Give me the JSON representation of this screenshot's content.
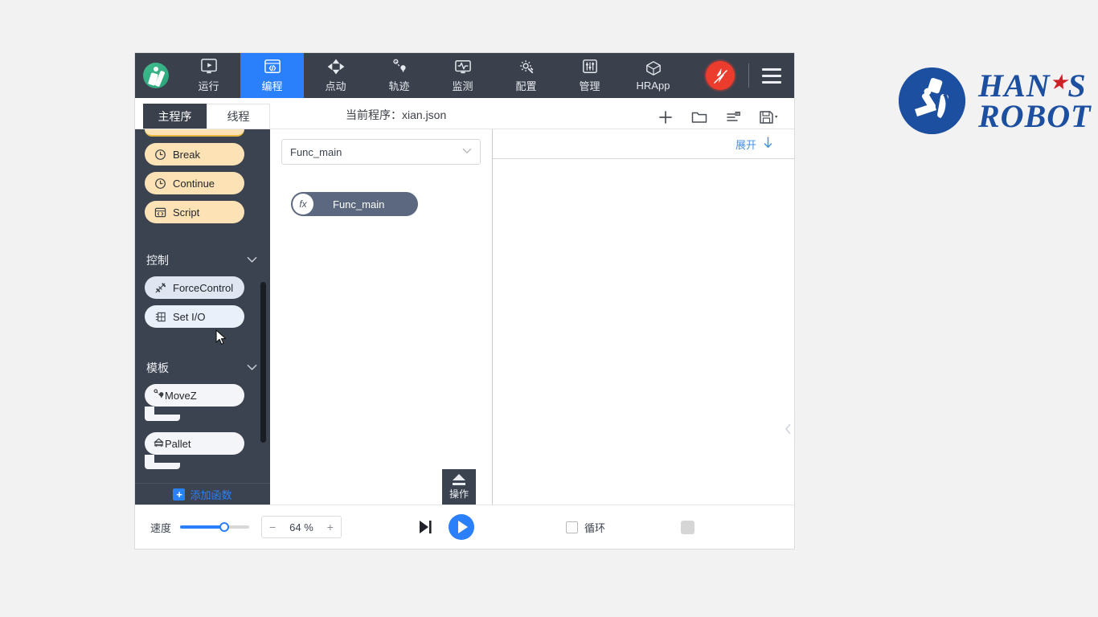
{
  "topnav": {
    "logo_name": "robot-logo",
    "items": [
      {
        "label": "运行",
        "icon": "run-icon",
        "active": false
      },
      {
        "label": "编程",
        "icon": "program-icon",
        "active": true
      },
      {
        "label": "点动",
        "icon": "jog-icon",
        "active": false
      },
      {
        "label": "轨迹",
        "icon": "trajectory-icon",
        "active": false
      },
      {
        "label": "监测",
        "icon": "monitor-icon",
        "active": false
      },
      {
        "label": "配置",
        "icon": "config-icon",
        "active": false
      },
      {
        "label": "管理",
        "icon": "manage-icon",
        "active": false
      },
      {
        "label": "HRApp",
        "icon": "hrapp-icon",
        "active": false
      }
    ],
    "estop_icon": "emergency-stop-icon",
    "menu_icon": "hamburger-menu-icon"
  },
  "toolbar": {
    "tabs": [
      {
        "label": "主程序",
        "active": true
      },
      {
        "label": "线程",
        "active": false
      }
    ],
    "program_title": "当前程序：xian.json",
    "actions": [
      {
        "name": "add-program-button",
        "icon": "plus-icon"
      },
      {
        "name": "open-folder-button",
        "icon": "folder-icon"
      },
      {
        "name": "variables-button",
        "icon": "variable-list-icon"
      },
      {
        "name": "save-button",
        "icon": "save-icon"
      }
    ]
  },
  "palette": {
    "blocks_top": [
      {
        "label": "",
        "icon": "",
        "style": "cut"
      },
      {
        "label": "Break",
        "icon": "clock-icon",
        "style": "yellow"
      },
      {
        "label": "Continue",
        "icon": "clock-icon",
        "style": "yellow"
      },
      {
        "label": "Script",
        "icon": "script-icon",
        "style": "yellow"
      }
    ],
    "section_control": {
      "title": "控制",
      "chevron": "chevron-down-icon",
      "blocks": [
        {
          "label": "ForceControl",
          "icon": "force-control-icon",
          "highlighted": false
        },
        {
          "label": "Set I/O",
          "icon": "io-icon",
          "highlighted": true
        }
      ]
    },
    "section_template": {
      "title": "模板",
      "chevron": "chevron-down-icon",
      "blocks": [
        {
          "label": "MoveZ",
          "icon": "move-waypoint-icon"
        },
        {
          "label": "Pallet",
          "icon": "pallet-icon"
        }
      ]
    },
    "add_function_label": "添加函数",
    "add_function_icon": "plus-square-icon",
    "collapse_icon": "chevron-left-icon"
  },
  "canvas": {
    "function_select_value": "Func_main",
    "function_select_chevron": "chevron-down-icon",
    "function_block_label": "Func_main",
    "function_block_badge": "fx",
    "operation_tab_label": "操作",
    "operation_tab_icon": "eject-icon"
  },
  "detail": {
    "expand_label": "展开",
    "expand_arrow_icon": "arrow-down-icon"
  },
  "bottombar": {
    "speed_label": "速度",
    "speed_value": "64 %",
    "speed_percent": 64,
    "minus_label": "−",
    "plus_label": "+",
    "step_icon": "step-forward-icon",
    "play_icon": "play-icon",
    "loop_label": "循环",
    "loop_checked": false,
    "stop_icon": "stop-icon"
  },
  "hans_logo": {
    "line1": "HAN",
    "star": "★",
    "line1_tail": "S",
    "line2": "ROBOT",
    "mark_name": "hans-robot-mark"
  },
  "colors": {
    "accent_blue": "#2a7ffb",
    "nav_dark": "#3a414c",
    "panel_dark": "#3c4350",
    "block_yellow": "#fce2b4",
    "block_blue": "#dfe6f1",
    "brand_blue": "#1d4fa0",
    "estop_red": "#ec3c2d",
    "page_bg": "#f2f2f2"
  }
}
